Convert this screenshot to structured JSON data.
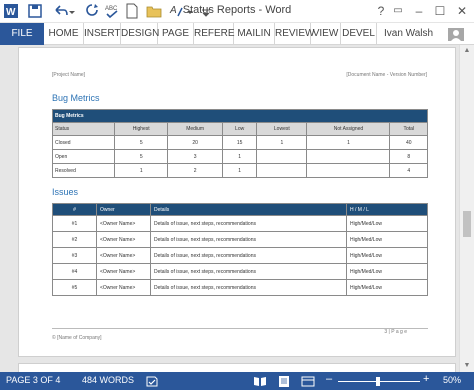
{
  "window": {
    "title": "Status Reports - Word",
    "help": "?",
    "ribbon_display": "▭",
    "minimize": "–",
    "maximize": "☐",
    "close": "✕"
  },
  "ribbon": {
    "tabs": [
      "FILE",
      "HOME",
      "INSERT",
      "DESIGN",
      "PAGE L",
      "REFERE",
      "MAILIN",
      "REVIEW",
      "VIEW",
      "DEVEL"
    ],
    "user": "Ivan Walsh"
  },
  "document": {
    "header_left": "[Project Name]",
    "header_right": "[Document Name - Version Number]",
    "bug_heading": "Bug Metrics",
    "bug_table": {
      "caption": "Bug Metrics",
      "columns": [
        "Status",
        "Highest",
        "Medium",
        "Low",
        "Lowest",
        "Not Assigned",
        "Total"
      ],
      "rows": [
        [
          "Closed",
          "5",
          "20",
          "15",
          "1",
          "1",
          "40"
        ],
        [
          "Open",
          "5",
          "3",
          "1",
          "",
          "",
          "8"
        ],
        [
          "Resolved",
          "1",
          "2",
          "1",
          "",
          "",
          "4"
        ]
      ]
    },
    "issues_heading": "Issues",
    "issues_table": {
      "columns": [
        "#",
        "Owner",
        "Details",
        "H / M / L"
      ],
      "rows": [
        [
          "#1",
          "<Owner Name>",
          "Details of issue, next steps, recommendations",
          "High/Med/Low"
        ],
        [
          "#2",
          "<Owner Name>",
          "Details of issue, next steps, recommendations",
          "High/Med/Low"
        ],
        [
          "#3",
          "<Owner Name>",
          "Details of issue, next steps, recommendations",
          "High/Med/Low"
        ],
        [
          "#4",
          "<Owner Name>",
          "Details of issue, next steps, recommendations",
          "High/Med/Low"
        ],
        [
          "#5",
          "<Owner Name>",
          "Details of issue, next steps, recommendations",
          "High/Med/Low"
        ]
      ]
    },
    "footer_left": "© [Name of Company]",
    "footer_right": "3 | P a g e"
  },
  "statusbar": {
    "page": "PAGE 3 OF 4",
    "words": "484 WORDS",
    "zoom": "50%",
    "minus": "–",
    "plus": "+"
  },
  "colors": {
    "accent": "#2b579a",
    "table_header": "#1f4e79",
    "heading": "#2e74b5"
  }
}
